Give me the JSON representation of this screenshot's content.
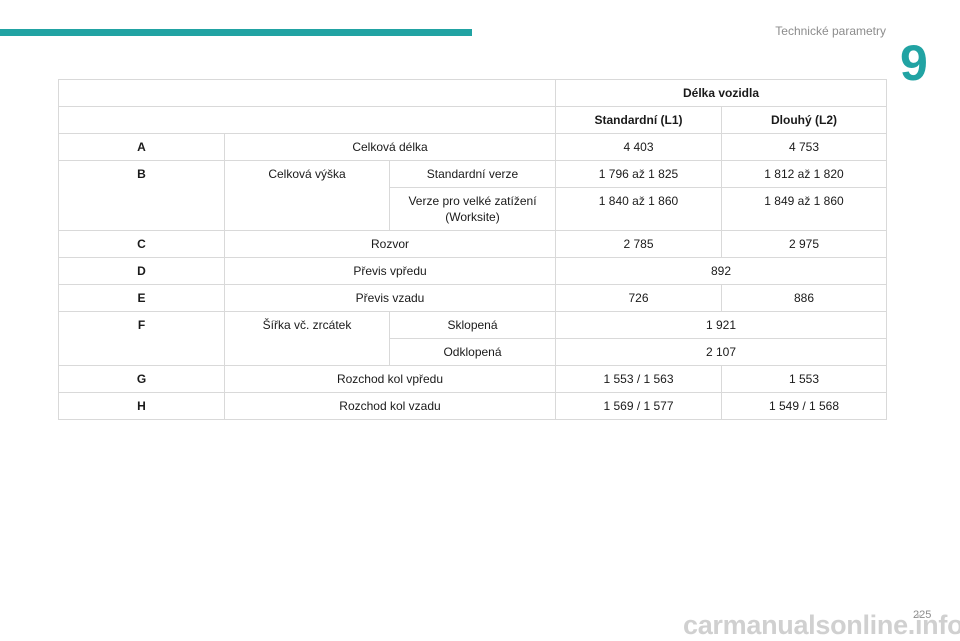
{
  "header": {
    "section_title": "Technické parametry",
    "chapter_number": "9",
    "accent_color": "#21a3a3"
  },
  "table": {
    "group_header": "Délka vozidla",
    "col_l1": "Standardní (L1)",
    "col_l2": "Dlouhý (L2)",
    "rows": {
      "A": {
        "code": "A",
        "label": "Celková délka",
        "l1": "4 403",
        "l2": "4 753"
      },
      "B": {
        "code": "B",
        "label": "Celková výška",
        "sub1": {
          "label": "Standardní verze",
          "l1": "1 796 až 1 825",
          "l2": "1 812 až 1 820"
        },
        "sub2": {
          "label": "Verze pro velké zatížení (Worksite)",
          "l1": "1 840 až 1 860",
          "l2": "1 849 až 1 860"
        }
      },
      "C": {
        "code": "C",
        "label": "Rozvor",
        "l1": "2 785",
        "l2": "2 975"
      },
      "D": {
        "code": "D",
        "label": "Převis vpředu",
        "value": "892"
      },
      "E": {
        "code": "E",
        "label": "Převis vzadu",
        "l1": "726",
        "l2": "886"
      },
      "F": {
        "code": "F",
        "label": "Šířka vč. zrcátek",
        "sub1": {
          "label": "Sklopená",
          "value": "1 921"
        },
        "sub2": {
          "label": "Odklopená",
          "value": "2 107"
        }
      },
      "G": {
        "code": "G",
        "label": "Rozchod kol vpředu",
        "l1": "1 553 / 1 563",
        "l2": "1 553"
      },
      "H": {
        "code": "H",
        "label": "Rozchod kol vzadu",
        "l1": "1 569 / 1 577",
        "l2": "1 549 / 1 568"
      }
    }
  },
  "footer": {
    "page_number": "225",
    "watermark": "carmanualsonline.info"
  }
}
